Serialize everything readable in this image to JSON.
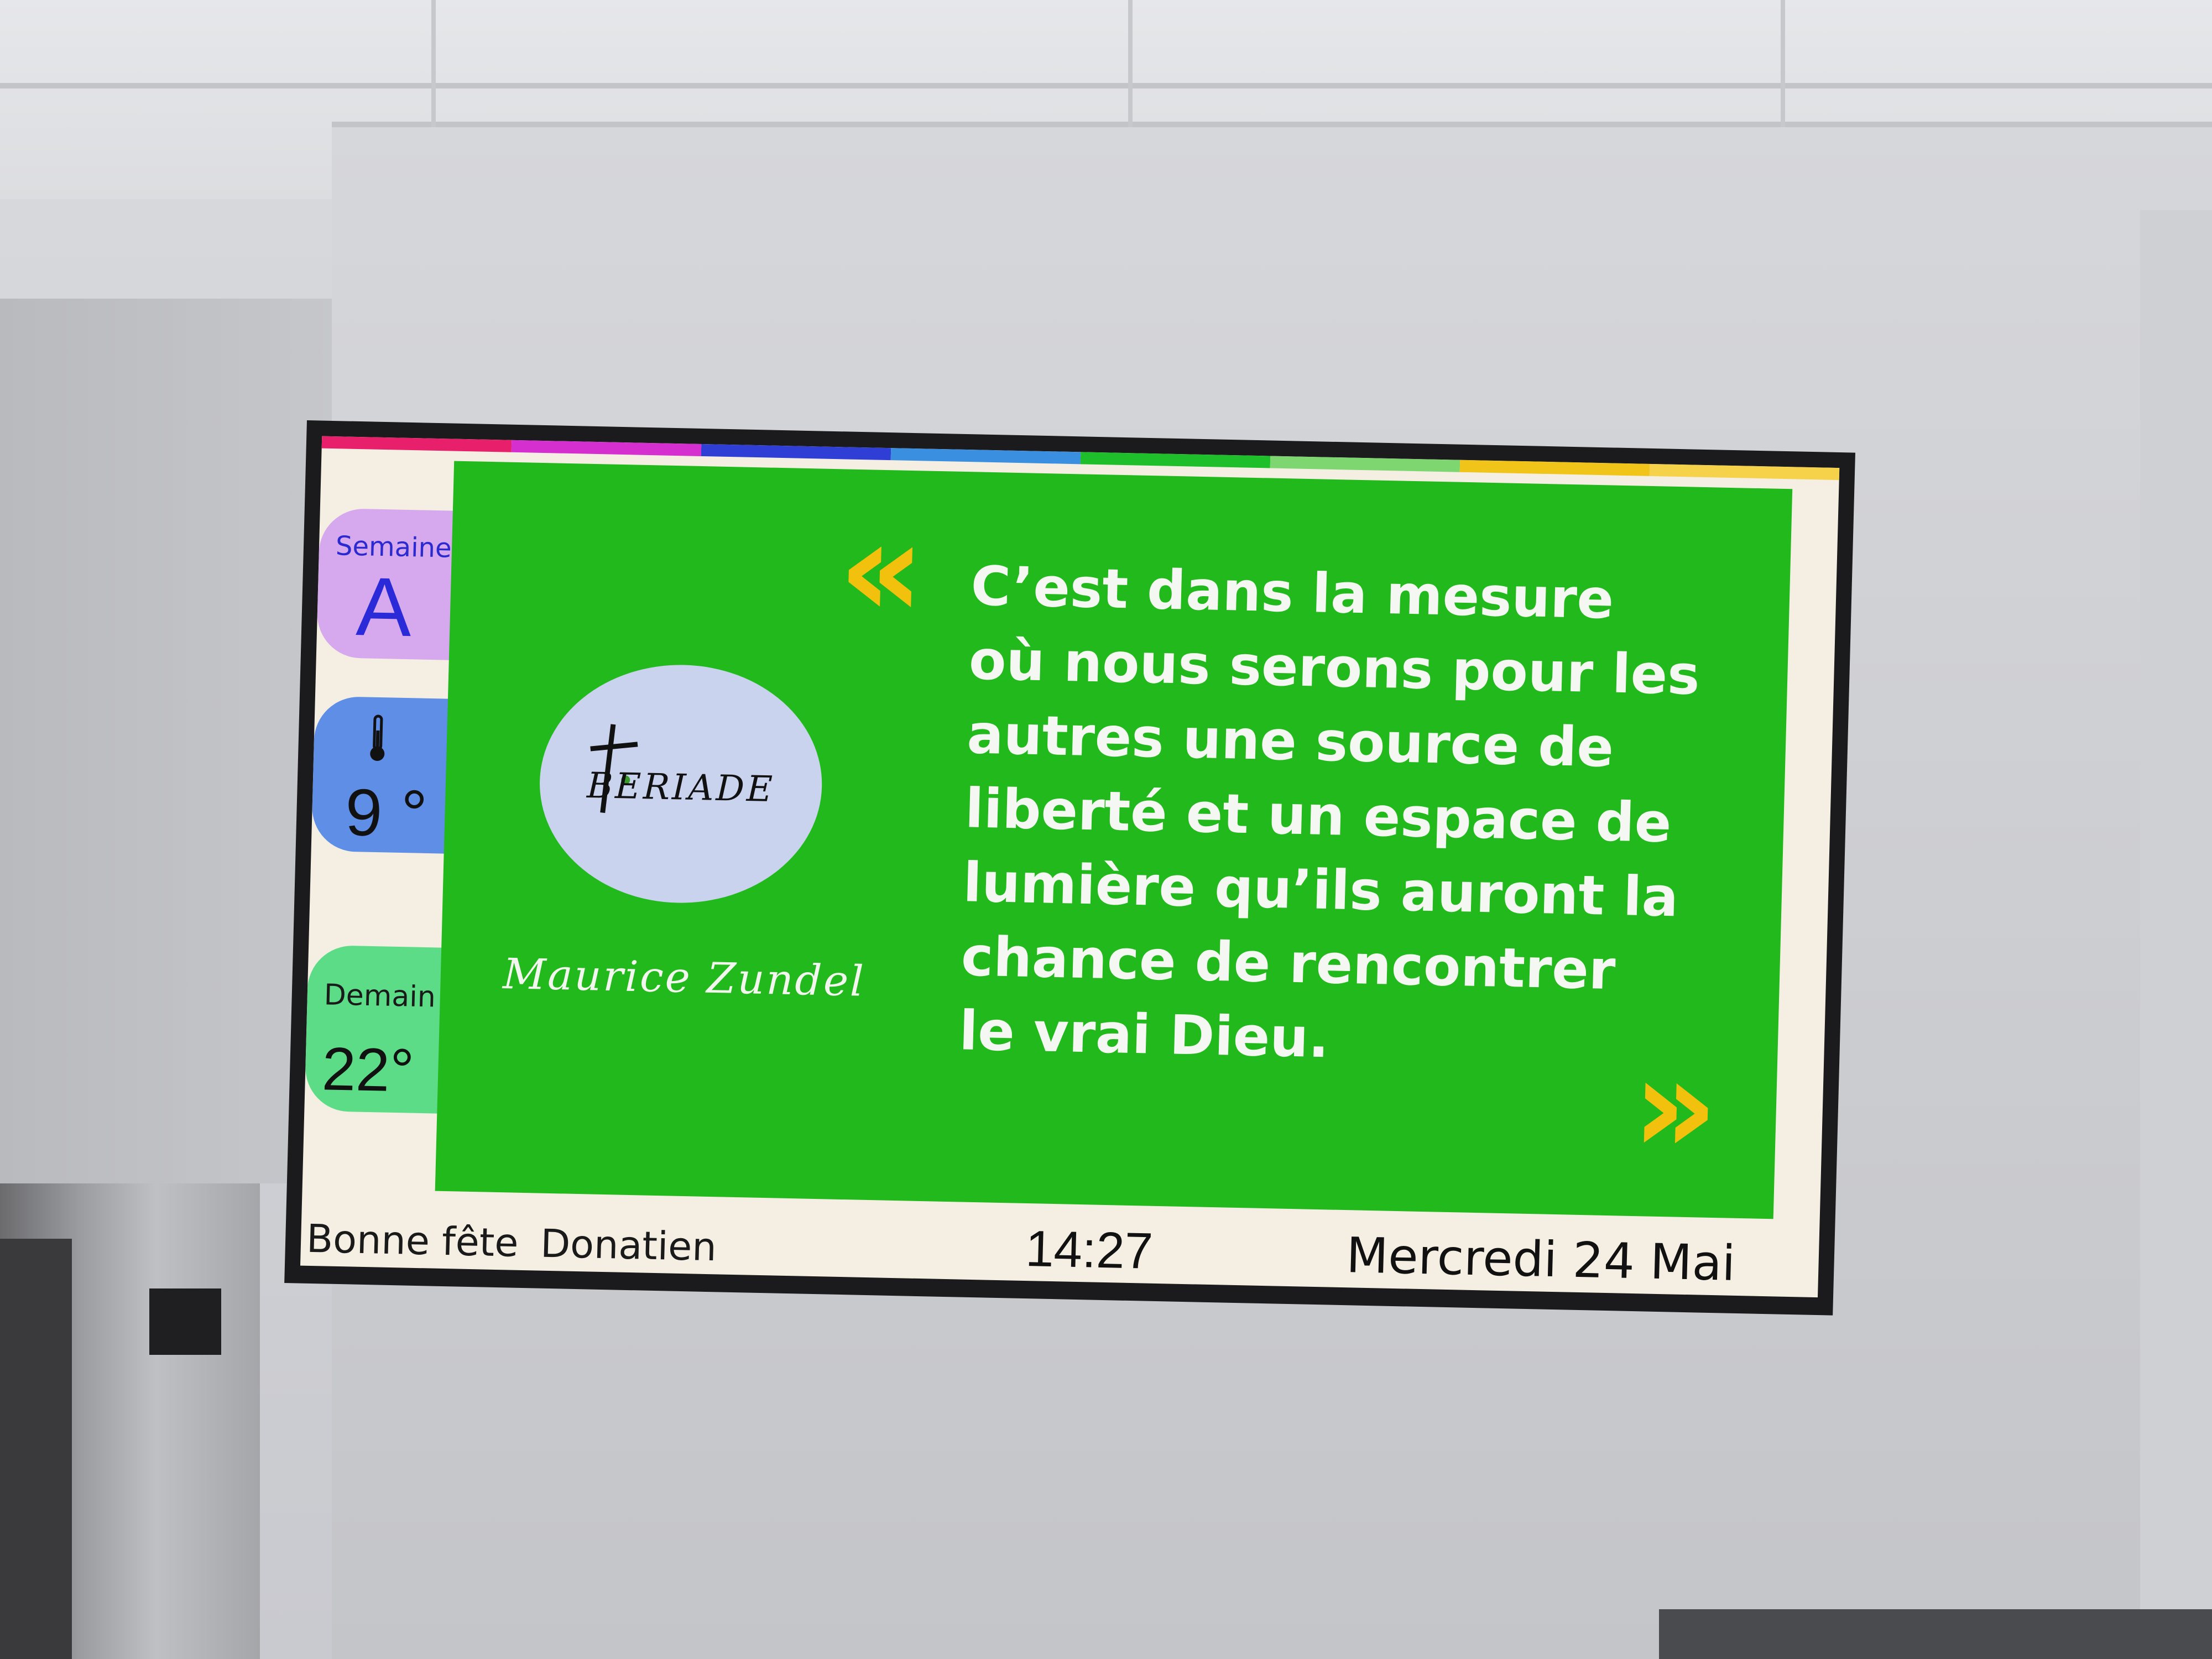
{
  "week": {
    "label": "Semaine",
    "value": "A"
  },
  "temperature": {
    "value": "9 °"
  },
  "forecast": {
    "label": "Demain",
    "value": "22°"
  },
  "logo": {
    "text": "BERIADE"
  },
  "quote": {
    "open_mark": "«",
    "close_mark": "»",
    "lines": [
      "C’est dans la mesure",
      "où nous serons pour les",
      "autres une source de",
      "liberté et un espace de",
      "lumière qu’ils auront la",
      "chance de rencontrer",
      "le vrai Dieu."
    ],
    "author": "Maurice Zundel"
  },
  "footer": {
    "feast_label": "Bonne fête",
    "feast_name": "Donatien",
    "time": "14:27",
    "date": "Mercredi 24 Mai"
  },
  "colors": {
    "strip": [
      "#e8206b",
      "#d62fd0",
      "#2f3fd6",
      "#3a8fe0",
      "#1fbf2c",
      "#7ed670",
      "#f0c419",
      "#f6d24a"
    ],
    "panel": "#22b91c",
    "quote_marks": "#f2c10e"
  },
  "icons": {
    "temperature": "thermometer-icon"
  }
}
